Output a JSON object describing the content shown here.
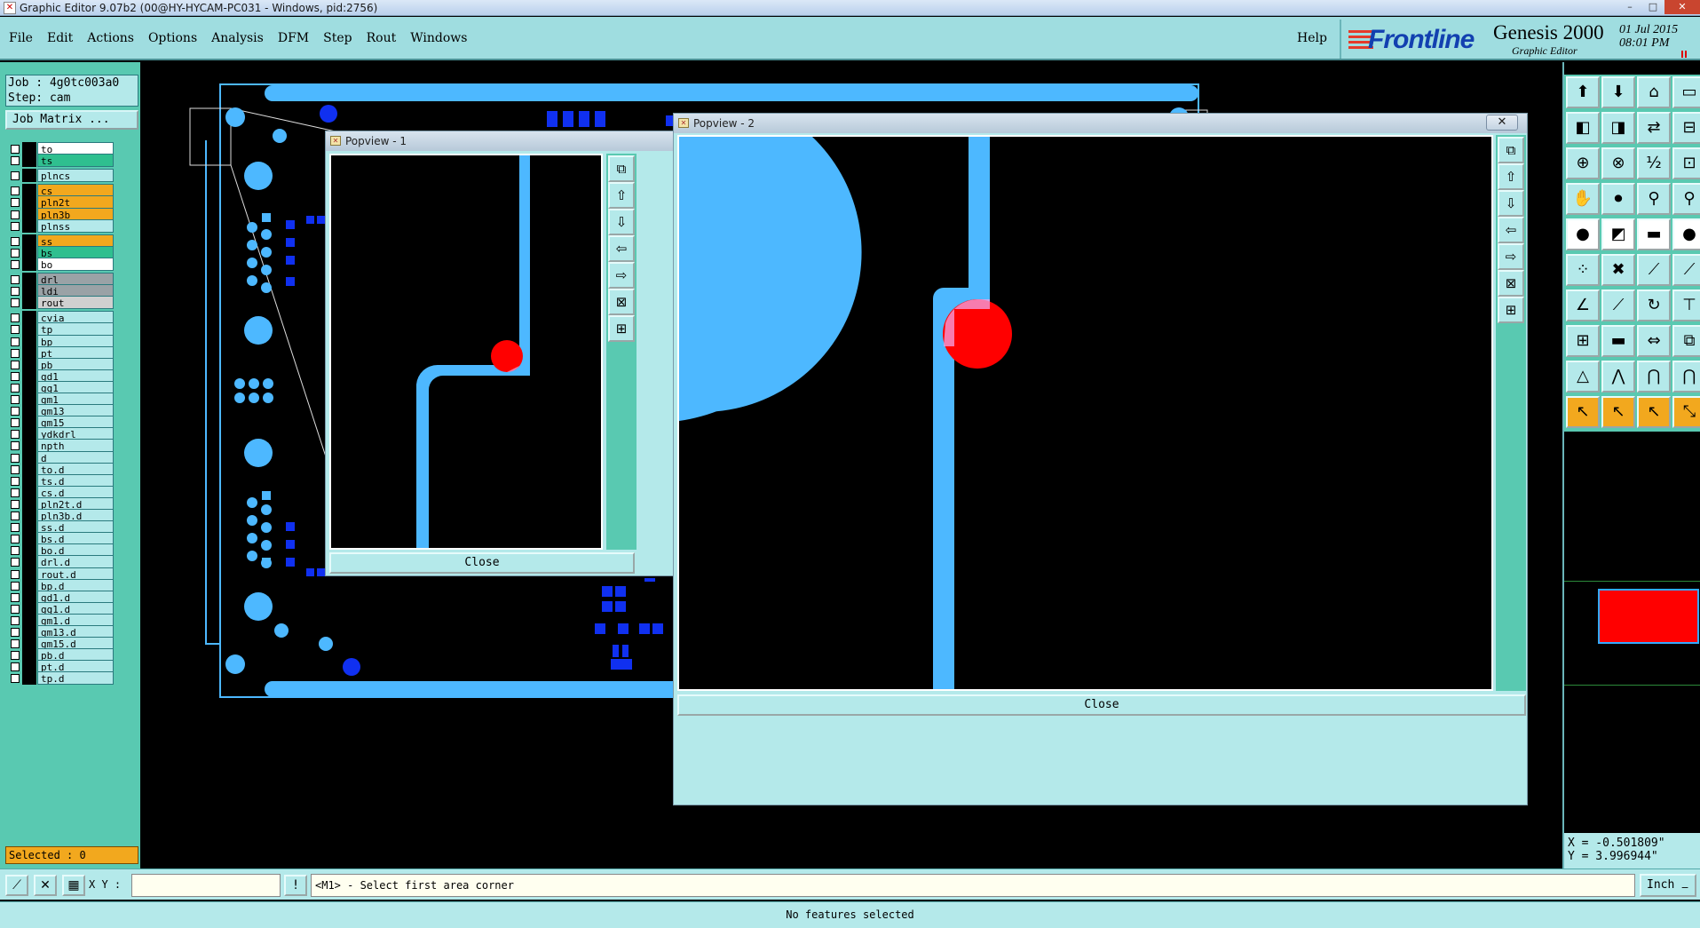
{
  "window": {
    "title": "Graphic Editor 9.07b2 (00@HY-HYCAM-PC031 - Windows, pid:2756)",
    "controls": [
      "minimize",
      "maximize",
      "close"
    ]
  },
  "menu": {
    "items": [
      "File",
      "Edit",
      "Actions",
      "Options",
      "Analysis",
      "DFM",
      "Step",
      "Rout",
      "Windows"
    ],
    "help": "Help"
  },
  "brand": {
    "logo": "Frontline",
    "product": "Genesis 2000",
    "subtitle": "Graphic Editor",
    "date": "01 Jul 2015",
    "time": "08:01 PM"
  },
  "job": {
    "job_label": "Job : 4g0tc003a0",
    "step_label": "Step: cam",
    "matrix_button": "Job Matrix ..."
  },
  "layers": [
    {
      "name": "to",
      "color": "#ffffff",
      "dot": ""
    },
    {
      "name": "ts",
      "color": "#2fbf8f",
      "dot": "#1f3fe0"
    },
    {
      "name": "plncs",
      "color": "#b4e9ea",
      "dot": ""
    },
    {
      "name": "cs",
      "color": "#f2a81e",
      "dot": ""
    },
    {
      "name": "pln2t",
      "color": "#f2a81e",
      "dot": ""
    },
    {
      "name": "pln3b",
      "color": "#f2a81e",
      "dot": ""
    },
    {
      "name": "plnss",
      "color": "#b4e9ea",
      "dot": ""
    },
    {
      "name": "ss",
      "color": "#f2a81e",
      "dot": ""
    },
    {
      "name": "bs",
      "color": "#2fbf8f",
      "dot": "#3fa52a"
    },
    {
      "name": "bo",
      "color": "#ffffff",
      "dot": ""
    },
    {
      "name": "drl",
      "color": "#9aa2a6",
      "dot": ""
    },
    {
      "name": "ldi",
      "color": "#9aa2a6",
      "dot": ""
    },
    {
      "name": "rout",
      "color": "#d0d0d0",
      "dot": ""
    },
    {
      "name": "cvia",
      "color": "#b4e9ea",
      "dot": ""
    },
    {
      "name": "tp",
      "color": "#b4e9ea",
      "dot": ""
    },
    {
      "name": "bp",
      "color": "#b4e9ea",
      "dot": ""
    },
    {
      "name": "pt",
      "color": "#b4e9ea",
      "dot": ""
    },
    {
      "name": "pb",
      "color": "#b4e9ea",
      "dot": ""
    },
    {
      "name": "gd1",
      "color": "#b4e9ea",
      "dot": ""
    },
    {
      "name": "gg1",
      "color": "#b4e9ea",
      "dot": ""
    },
    {
      "name": "gm1",
      "color": "#b4e9ea",
      "dot": ""
    },
    {
      "name": "gm13",
      "color": "#b4e9ea",
      "dot": ""
    },
    {
      "name": "gm15",
      "color": "#b4e9ea",
      "dot": ""
    },
    {
      "name": "ydkdrl",
      "color": "#b4e9ea",
      "dot": ""
    },
    {
      "name": "npth",
      "color": "#b4e9ea",
      "dot": "#ff2020"
    },
    {
      "name": "d",
      "color": "#b4e9ea",
      "dot": ""
    },
    {
      "name": "to.d",
      "color": "#b4e9ea",
      "dot": ""
    },
    {
      "name": "ts.d",
      "color": "#b4e9ea",
      "dot": ""
    },
    {
      "name": "cs.d",
      "color": "#b4e9ea",
      "dot": ""
    },
    {
      "name": "pln2t.d",
      "color": "#b4e9ea",
      "dot": ""
    },
    {
      "name": "pln3b.d",
      "color": "#b4e9ea",
      "dot": ""
    },
    {
      "name": "ss.d",
      "color": "#b4e9ea",
      "dot": ""
    },
    {
      "name": "bs.d",
      "color": "#b4e9ea",
      "dot": ""
    },
    {
      "name": "bo.d",
      "color": "#b4e9ea",
      "dot": ""
    },
    {
      "name": "drl.d",
      "color": "#b4e9ea",
      "dot": ""
    },
    {
      "name": "rout.d",
      "color": "#b4e9ea",
      "dot": ""
    },
    {
      "name": "bp.d",
      "color": "#b4e9ea",
      "dot": ""
    },
    {
      "name": "gd1.d",
      "color": "#b4e9ea",
      "dot": ""
    },
    {
      "name": "gg1.d",
      "color": "#b4e9ea",
      "dot": ""
    },
    {
      "name": "gm1.d",
      "color": "#b4e9ea",
      "dot": ""
    },
    {
      "name": "gm13.d",
      "color": "#b4e9ea",
      "dot": ""
    },
    {
      "name": "gm15.d",
      "color": "#b4e9ea",
      "dot": ""
    },
    {
      "name": "pb.d",
      "color": "#b4e9ea",
      "dot": ""
    },
    {
      "name": "pt.d",
      "color": "#b4e9ea",
      "dot": ""
    },
    {
      "name": "tp.d",
      "color": "#b4e9ea",
      "dot": ""
    }
  ],
  "selected_label": "Selected : 0",
  "popview1": {
    "title": "Popview - 1",
    "close": "Close"
  },
  "popview2": {
    "title": "Popview - 2",
    "close": "Close"
  },
  "coords": {
    "x": "X = -0.501809\"",
    "y": "Y = 3.996944\""
  },
  "command": {
    "xy_label": "X Y :",
    "xy_value": "",
    "prompt": "<M1> - Select first area corner",
    "units": "Inch"
  },
  "status": "No features selected",
  "colors": {
    "panel_teal": "#59c9b1",
    "panel_light": "#b4e9ea",
    "feature_blue": "#4db8ff",
    "pad_blue": "#1030f0",
    "highlight_red": "#ff0000"
  }
}
